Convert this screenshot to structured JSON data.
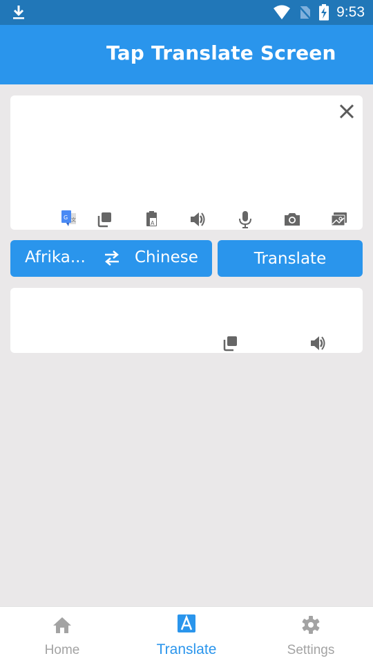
{
  "status_bar": {
    "time": "9:53",
    "icons": [
      "download-icon",
      "wifi-icon",
      "no-sim-icon",
      "battery-charging-icon"
    ]
  },
  "app_bar": {
    "title": "Tap Translate Screen"
  },
  "input_card": {
    "text": "",
    "actions": [
      "google-translate-icon",
      "copy-icon",
      "paste-icon",
      "speaker-icon",
      "microphone-icon",
      "camera-icon",
      "gallery-icon"
    ],
    "close_icon": "close-icon"
  },
  "language_bar": {
    "source_language": "Afrika...",
    "swap_icon": "swap-icon",
    "target_language": "Chinese",
    "translate_label": "Translate"
  },
  "output_card": {
    "text": "",
    "actions": [
      "copy-icon",
      "speaker-icon"
    ]
  },
  "bottom_nav": {
    "items": [
      {
        "label": "Home",
        "icon": "home-icon",
        "active": false
      },
      {
        "label": "Translate",
        "icon": "translate-icon",
        "active": true
      },
      {
        "label": "Settings",
        "icon": "gear-icon",
        "active": false
      }
    ]
  },
  "colors": {
    "primary": "#2a95ec",
    "status_bar": "#2177b8",
    "background": "#eae8e9",
    "icon_gray": "#6b6b6b",
    "inactive_nav": "#a3a3a3"
  }
}
